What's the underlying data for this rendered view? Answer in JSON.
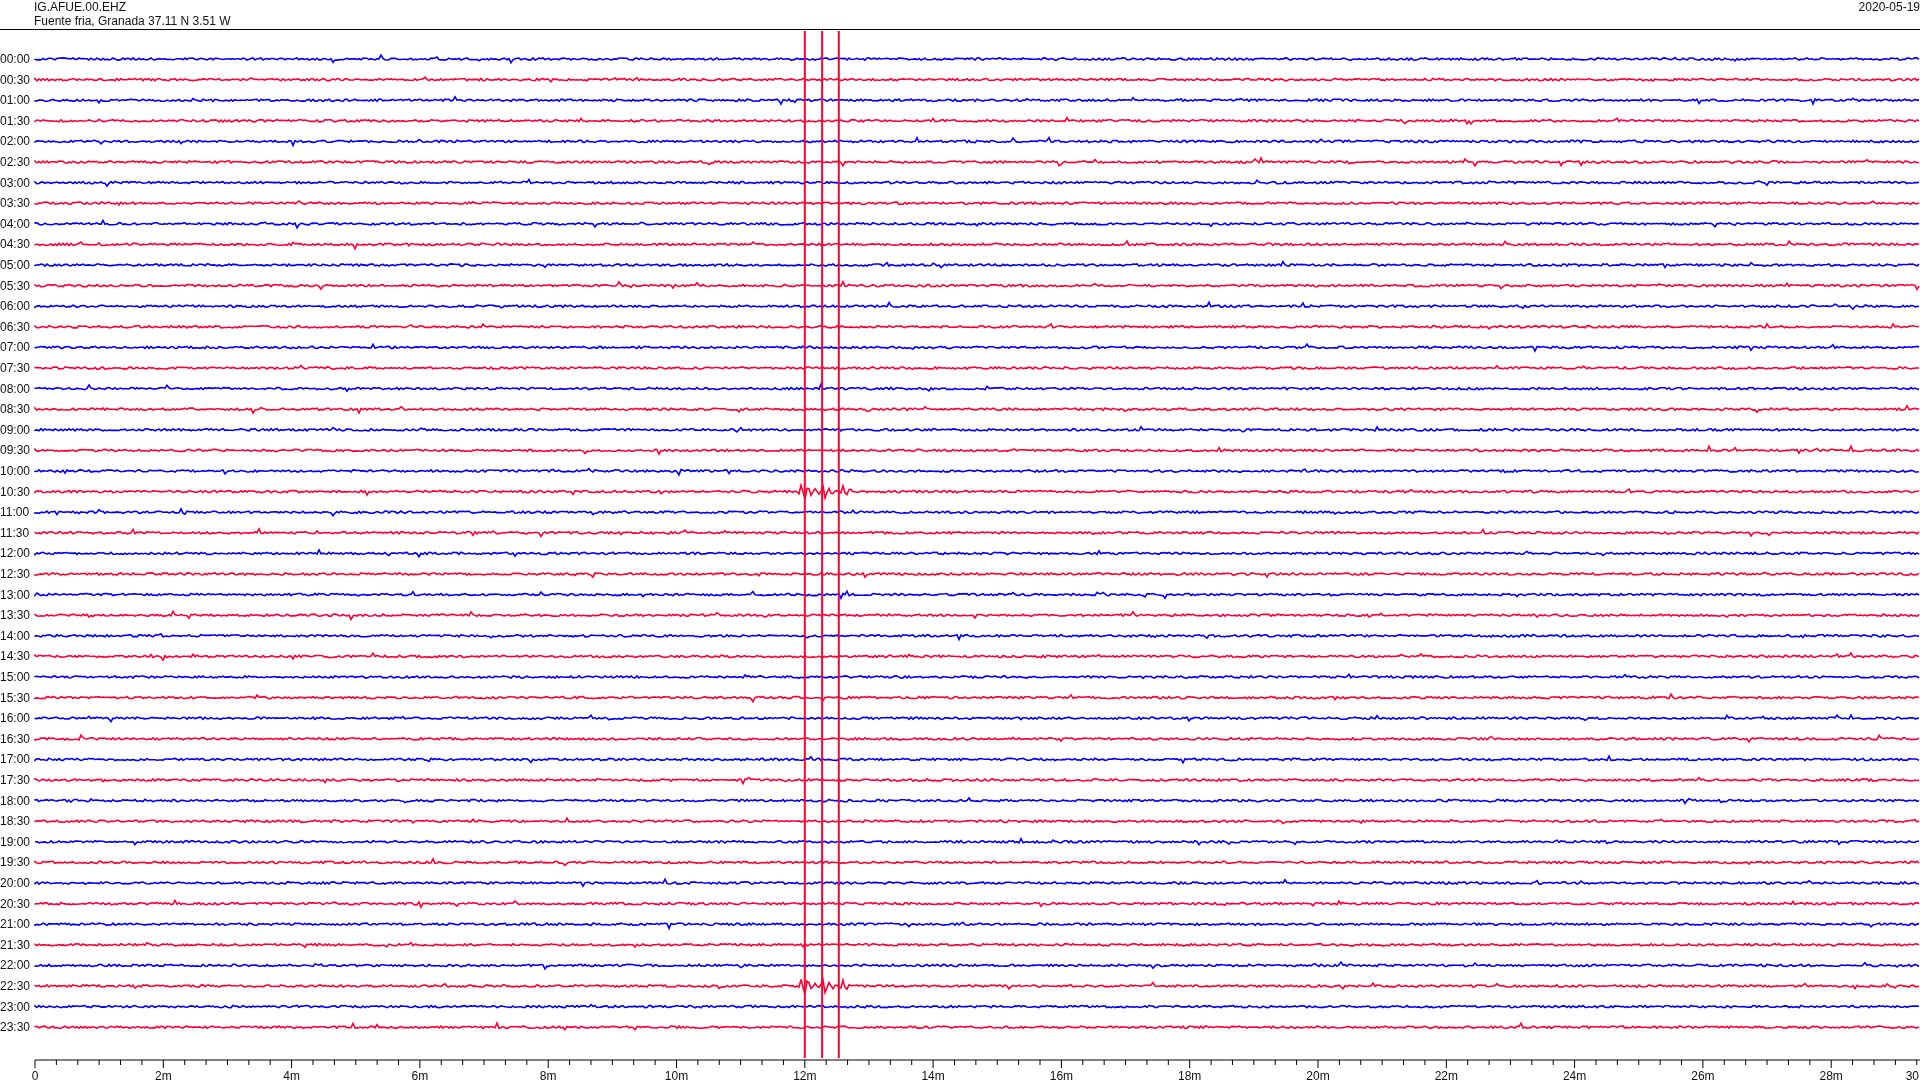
{
  "header": {
    "station": "IG.AFUE.00.EHZ",
    "location": "Fuente fria, Granada  37.11 N 3.51 W",
    "date": "2020-05-19"
  },
  "rows": [
    {
      "time": "00:00",
      "color": "#0000ff"
    },
    {
      "time": "00:30",
      "color": "#ff0033"
    },
    {
      "time": "01:00",
      "color": "#0000ff"
    },
    {
      "time": "01:30",
      "color": "#ff0033"
    },
    {
      "time": "02:00",
      "color": "#0000ff"
    },
    {
      "time": "02:30",
      "color": "#ff0033"
    },
    {
      "time": "03:00",
      "color": "#0000ff"
    },
    {
      "time": "03:30",
      "color": "#ff0033"
    },
    {
      "time": "04:00",
      "color": "#0000ff"
    },
    {
      "time": "04:30",
      "color": "#ff0033"
    },
    {
      "time": "05:00",
      "color": "#0000ff"
    },
    {
      "time": "05:30",
      "color": "#ff0033"
    },
    {
      "time": "06:00",
      "color": "#0000ff"
    },
    {
      "time": "06:30",
      "color": "#ff0033"
    },
    {
      "time": "07:00",
      "color": "#0000ff"
    },
    {
      "time": "07:30",
      "color": "#ff0033"
    },
    {
      "time": "08:00",
      "color": "#0000ff"
    },
    {
      "time": "08:30",
      "color": "#ff0033"
    },
    {
      "time": "09:00",
      "color": "#0000ff"
    },
    {
      "time": "09:30",
      "color": "#ff0033"
    },
    {
      "time": "10:00",
      "color": "#0000ff"
    },
    {
      "time": "10:30",
      "color": "#ff0033"
    },
    {
      "time": "11:00",
      "color": "#0000ff"
    },
    {
      "time": "11:30",
      "color": "#ff0033"
    },
    {
      "time": "12:00",
      "color": "#0000ff"
    },
    {
      "time": "12:30",
      "color": "#ff0033"
    },
    {
      "time": "13:00",
      "color": "#0000ff"
    },
    {
      "time": "13:30",
      "color": "#ff0033"
    },
    {
      "time": "14:00",
      "color": "#0000ff"
    },
    {
      "time": "14:30",
      "color": "#ff0033"
    },
    {
      "time": "15:00",
      "color": "#0000ff"
    },
    {
      "time": "15:30",
      "color": "#ff0033"
    },
    {
      "time": "16:00",
      "color": "#0000ff"
    },
    {
      "time": "16:30",
      "color": "#ff0033"
    },
    {
      "time": "17:00",
      "color": "#0000ff"
    },
    {
      "time": "17:30",
      "color": "#ff0033"
    },
    {
      "time": "18:00",
      "color": "#0000ff"
    },
    {
      "time": "18:30",
      "color": "#ff0033"
    },
    {
      "time": "19:00",
      "color": "#0000ff"
    },
    {
      "time": "19:30",
      "color": "#ff0033"
    },
    {
      "time": "20:00",
      "color": "#0000ff"
    },
    {
      "time": "20:30",
      "color": "#ff0033"
    },
    {
      "time": "21:00",
      "color": "#0000ff"
    },
    {
      "time": "21:30",
      "color": "#ff0033"
    },
    {
      "time": "22:00",
      "color": "#0000ff"
    },
    {
      "time": "22:30",
      "color": "#ff0033"
    },
    {
      "time": "23:00",
      "color": "#0000ff"
    },
    {
      "time": "23:30",
      "color": "#ff0033"
    }
  ],
  "axis": {
    "labels": [
      "0",
      "2m",
      "4m",
      "6m",
      "8m",
      "10m",
      "12m",
      "14m",
      "16m",
      "18m",
      "20m",
      "22m",
      "24m",
      "26m",
      "28m",
      "30"
    ]
  }
}
